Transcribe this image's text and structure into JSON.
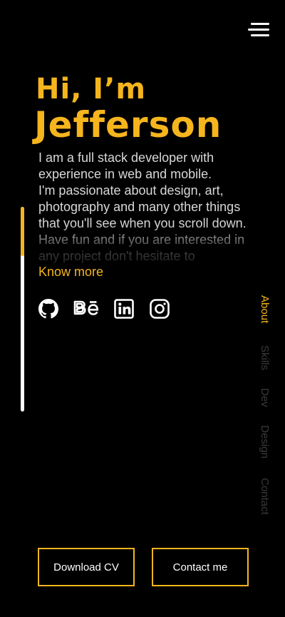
{
  "header": {
    "menu_icon": "hamburger-menu-icon"
  },
  "hero": {
    "greeting": "Hi, I’m",
    "name": "Jefferson"
  },
  "bio": {
    "lines": [
      "I am a full stack developer with experience in web and mobile.",
      "I'm passionate about design, art, photography and many other things that you'll see when you scroll down.",
      "Have fun and if you are interested in any project don't hesitate to"
    ],
    "know_more": "Know more"
  },
  "socials": [
    {
      "name": "github",
      "icon": "github-icon"
    },
    {
      "name": "behance",
      "icon": "behance-icon"
    },
    {
      "name": "linkedin",
      "icon": "linkedin-icon"
    },
    {
      "name": "instagram",
      "icon": "instagram-icon"
    }
  ],
  "side_nav": {
    "items": [
      {
        "label": "About",
        "active": true
      },
      {
        "label": "Skills",
        "active": false
      },
      {
        "label": "Dev",
        "active": false
      },
      {
        "label": "Design",
        "active": false
      },
      {
        "label": "Contact",
        "active": false
      }
    ]
  },
  "scroll_progress": 0.24,
  "actions": {
    "download_cv": "Download CV",
    "contact_me": "Contact me"
  },
  "colors": {
    "background": "#000000",
    "accent": "#f5b51d",
    "text": "#d8d8d8",
    "nav_inactive": "#3a3a3a"
  }
}
